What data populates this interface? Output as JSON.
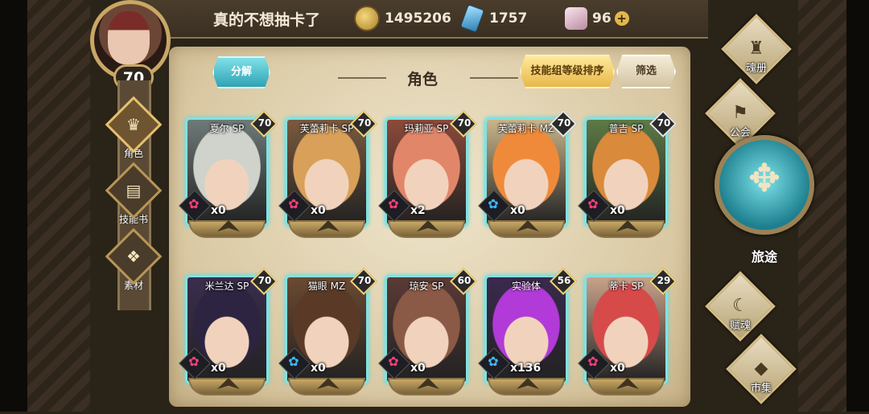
{
  "header": {
    "player_name": "真的不想抽卡了",
    "gold": "1495206",
    "crystals": "1757",
    "shards": "96",
    "player_level": "70"
  },
  "left_nav": [
    {
      "label": "角色",
      "icon": "character-icon",
      "active": true
    },
    {
      "label": "技能书",
      "icon": "skillbook-icon",
      "active": false
    },
    {
      "label": "素材",
      "icon": "material-icon",
      "active": false
    }
  ],
  "panel": {
    "title": "角色",
    "decompose_label": "分解",
    "sort_label": "技能组等级排序",
    "filter_label": "筛选"
  },
  "cards": [
    {
      "name": "夏尔 SP",
      "level": "70",
      "count": "x0",
      "shard_color": "#ff3f7a",
      "art": "#6e7a78",
      "hair": "#cfd3cc"
    },
    {
      "name": "芙蕾莉卡 SP",
      "level": "70",
      "count": "x0",
      "shard_color": "#ff3f7a",
      "art": "#7a5a3e",
      "hair": "#d9a05a"
    },
    {
      "name": "玛莉亚 SP",
      "level": "70",
      "count": "x2",
      "shard_color": "#ff3f7a",
      "art": "#8c4a3a",
      "hair": "#e2866a"
    },
    {
      "name": "芙蕾莉卡 MZ",
      "level": "70",
      "count": "x0",
      "shard_color": "#3fb8ff",
      "art": "#c9b58a",
      "hair": "#ef8a3a"
    },
    {
      "name": "普吉 SP",
      "level": "70",
      "count": "x0",
      "shard_color": "#ff3f7a",
      "art": "#5d7a46",
      "hair": "#d98a3a"
    },
    {
      "name": "米兰达 SP",
      "level": "70",
      "count": "x0",
      "shard_color": "#ff3f7a",
      "art": "#3a2d4e",
      "hair": "#2c2440"
    },
    {
      "name": "猫眼 MZ",
      "level": "70",
      "count": "x0",
      "shard_color": "#3fb8ff",
      "art": "#6a4a32",
      "hair": "#5a3a26"
    },
    {
      "name": "琼安 SP",
      "level": "60",
      "count": "x0",
      "shard_color": "#ff3f7a",
      "art": "#5a3a36",
      "hair": "#8a5a46"
    },
    {
      "name": "实验体",
      "level": "56",
      "count": "x136",
      "shard_color": "#3fb8ff",
      "art": "#3a2a4e",
      "hair": "#b23ad8"
    },
    {
      "name": "蒂卡 SP",
      "level": "29",
      "count": "x0",
      "shard_color": "#ff3f7a",
      "art": "#c9a28a",
      "hair": "#d64a4a"
    }
  ],
  "right_nav": [
    {
      "label": "魂册",
      "icon": "soulbook-icon"
    },
    {
      "label": "公会",
      "icon": "guild-icon"
    },
    {
      "label": "旅途",
      "icon": "journey-icon"
    },
    {
      "label": "赋魂",
      "icon": "enchant-icon"
    },
    {
      "label": "市集",
      "icon": "market-icon"
    }
  ]
}
